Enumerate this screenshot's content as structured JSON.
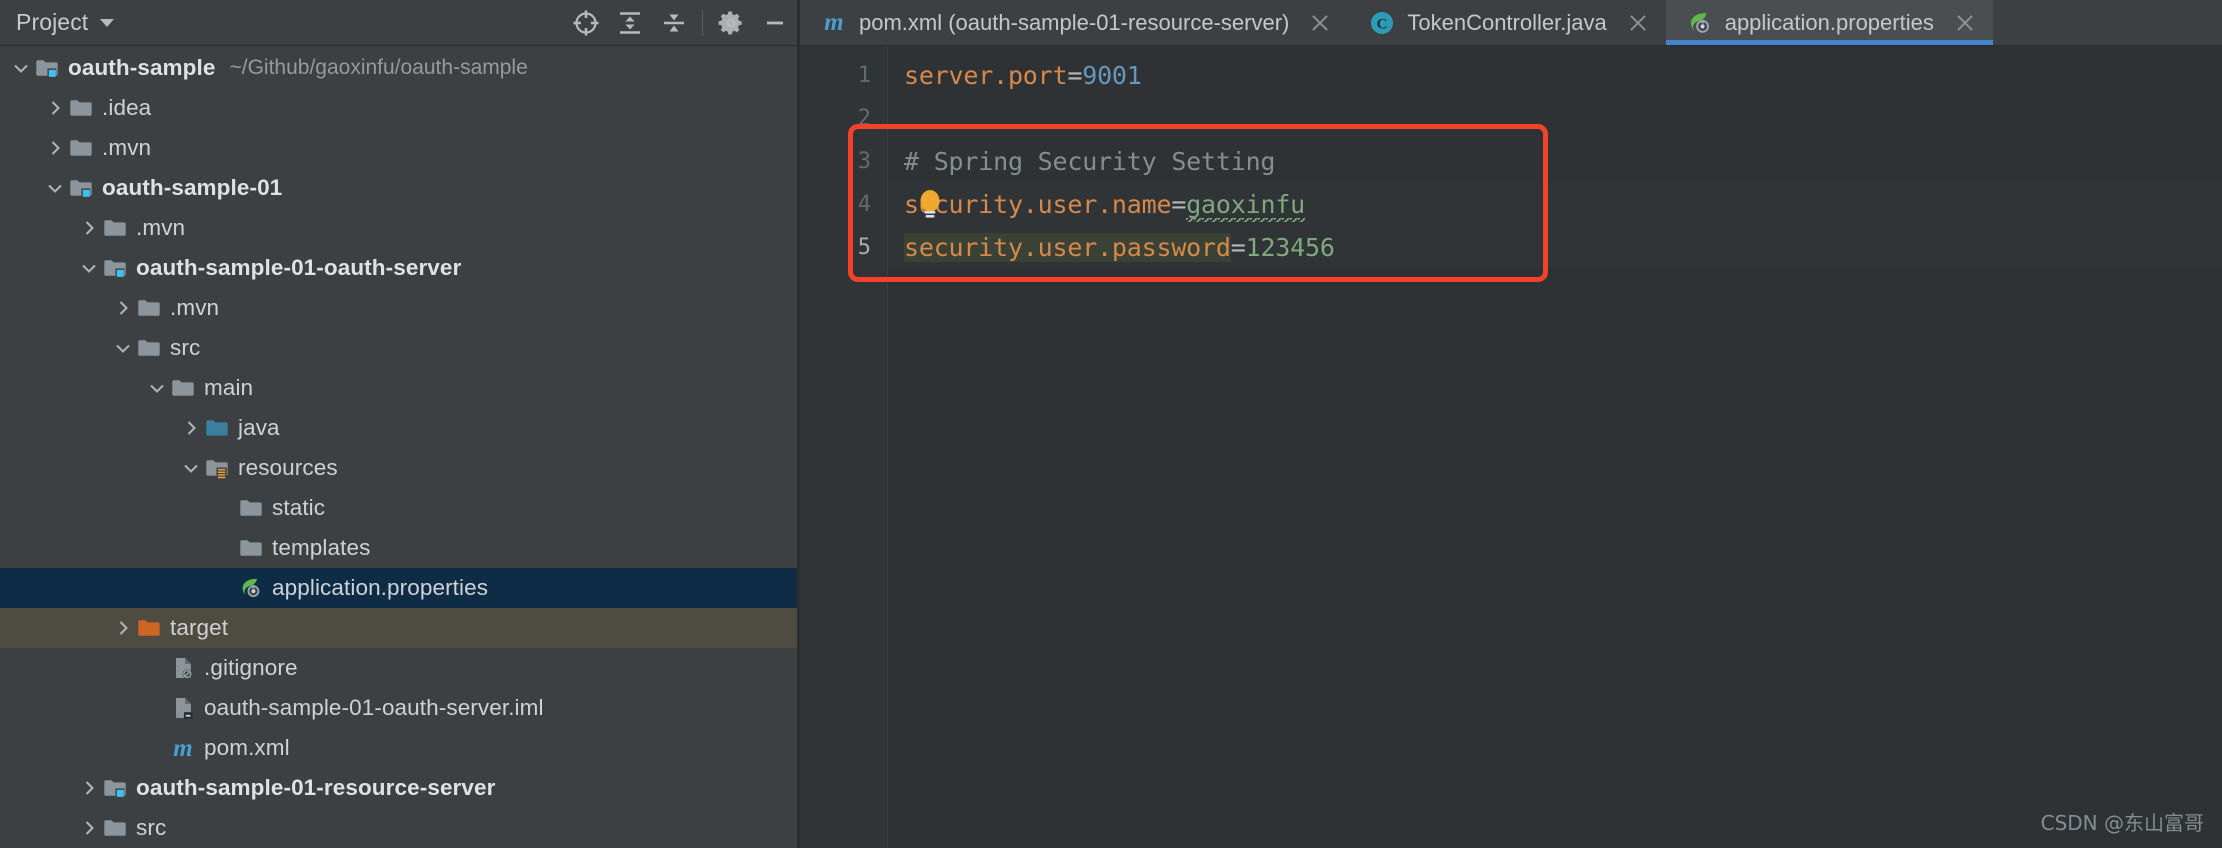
{
  "panel": {
    "title": "Project",
    "title_caret_icon": "chevron-down-icon",
    "toolbar": [
      {
        "name": "locate-in-tree-icon",
        "label": "Select Opened File"
      },
      {
        "name": "expand-all-icon",
        "label": "Expand All"
      },
      {
        "name": "collapse-all-icon",
        "label": "Collapse All"
      },
      {
        "name": "gear-icon",
        "label": "Settings"
      },
      {
        "name": "minimize-icon",
        "label": "Hide"
      }
    ]
  },
  "tree": [
    {
      "label": "oauth-sample",
      "hint": "~/Github/gaoxinfu/oauth-sample",
      "depth": 0,
      "twisty": "expanded",
      "icon": "module-folder-icon",
      "bold": true,
      "state": "normal"
    },
    {
      "label": ".idea",
      "hint": "",
      "depth": 1,
      "twisty": "collapsed",
      "icon": "folder-icon",
      "bold": false,
      "state": "normal"
    },
    {
      "label": ".mvn",
      "hint": "",
      "depth": 1,
      "twisty": "collapsed",
      "icon": "folder-icon",
      "bold": false,
      "state": "normal"
    },
    {
      "label": "oauth-sample-01",
      "hint": "",
      "depth": 1,
      "twisty": "expanded",
      "icon": "module-folder-icon",
      "bold": true,
      "state": "normal"
    },
    {
      "label": ".mvn",
      "hint": "",
      "depth": 2,
      "twisty": "collapsed",
      "icon": "folder-icon",
      "bold": false,
      "state": "normal"
    },
    {
      "label": "oauth-sample-01-oauth-server",
      "hint": "",
      "depth": 2,
      "twisty": "expanded",
      "icon": "module-folder-icon",
      "bold": true,
      "state": "normal"
    },
    {
      "label": ".mvn",
      "hint": "",
      "depth": 3,
      "twisty": "collapsed",
      "icon": "folder-icon",
      "bold": false,
      "state": "normal"
    },
    {
      "label": "src",
      "hint": "",
      "depth": 3,
      "twisty": "expanded",
      "icon": "folder-icon",
      "bold": false,
      "state": "normal"
    },
    {
      "label": "main",
      "hint": "",
      "depth": 4,
      "twisty": "expanded",
      "icon": "folder-icon",
      "bold": false,
      "state": "normal"
    },
    {
      "label": "java",
      "hint": "",
      "depth": 5,
      "twisty": "collapsed",
      "icon": "source-root-folder-icon",
      "bold": false,
      "state": "normal"
    },
    {
      "label": "resources",
      "hint": "",
      "depth": 5,
      "twisty": "expanded",
      "icon": "resources-root-folder-icon",
      "bold": false,
      "state": "normal"
    },
    {
      "label": "static",
      "hint": "",
      "depth": 6,
      "twisty": "none",
      "icon": "folder-icon",
      "bold": false,
      "state": "normal"
    },
    {
      "label": "templates",
      "hint": "",
      "depth": 6,
      "twisty": "none",
      "icon": "folder-icon",
      "bold": false,
      "state": "normal"
    },
    {
      "label": "application.properties",
      "hint": "",
      "depth": 6,
      "twisty": "none",
      "icon": "spring-properties-icon",
      "bold": false,
      "state": "selected"
    },
    {
      "label": "target",
      "hint": "",
      "depth": 3,
      "twisty": "collapsed",
      "icon": "excluded-folder-icon",
      "bold": false,
      "state": "excluded"
    },
    {
      "label": ".gitignore",
      "hint": "",
      "depth": 4,
      "twisty": "none",
      "icon": "gitignore-file-icon",
      "bold": false,
      "state": "normal"
    },
    {
      "label": "oauth-sample-01-oauth-server.iml",
      "hint": "",
      "depth": 4,
      "twisty": "none",
      "icon": "iml-file-icon",
      "bold": false,
      "state": "normal"
    },
    {
      "label": "pom.xml",
      "hint": "",
      "depth": 4,
      "twisty": "none",
      "icon": "maven-file-icon",
      "bold": false,
      "state": "normal"
    },
    {
      "label": "oauth-sample-01-resource-server",
      "hint": "",
      "depth": 2,
      "twisty": "collapsed",
      "icon": "module-folder-icon",
      "bold": true,
      "state": "normal"
    },
    {
      "label": "src",
      "hint": "",
      "depth": 2,
      "twisty": "collapsed",
      "icon": "folder-icon",
      "bold": false,
      "state": "normal"
    }
  ],
  "tabs": [
    {
      "label": "pom.xml (oauth-sample-01-resource-server)",
      "icon": "maven-file-icon",
      "active": false
    },
    {
      "label": "TokenController.java",
      "icon": "java-class-icon",
      "active": false
    },
    {
      "label": "application.properties",
      "icon": "spring-properties-icon",
      "active": true
    }
  ],
  "editor": {
    "line_numbers": [
      "1",
      "2",
      "3",
      "4",
      "5"
    ],
    "lines": [
      {
        "num": "1",
        "type": "kv",
        "key": "server.port",
        "eq": "=",
        "value": "9001",
        "value_kind": "number"
      },
      {
        "num": "2",
        "type": "blank",
        "key": "",
        "eq": "",
        "value": "",
        "value_kind": ""
      },
      {
        "num": "3",
        "type": "comment",
        "key": "",
        "eq": "",
        "value": "# Spring Security Setting",
        "value_kind": "comment"
      },
      {
        "num": "4",
        "type": "kv",
        "key": "security.user.name",
        "eq": "=",
        "value": "gaoxinfu",
        "value_kind": "string-typo"
      },
      {
        "num": "5",
        "type": "kv",
        "key": "security.user.password",
        "eq": "=",
        "value": "123456",
        "value_kind": "string"
      }
    ],
    "intention_icon": "lightbulb-icon",
    "annotation": {
      "name": "red-highlight-box",
      "color": "#f4422a"
    }
  },
  "watermark": "CSDN @东山富哥",
  "colors": {
    "panel_bg": "#3c4043",
    "editor_bg": "#2f3234",
    "selection_bg": "#0f2c46",
    "excluded_bg": "#4e4b41",
    "accent_blue": "#4285cd",
    "key_orange": "#d7884b",
    "value_green": "#7fa87f",
    "number_blue": "#6897bb",
    "comment_gray": "#878c8e",
    "annotation_red": "#f4422a"
  }
}
